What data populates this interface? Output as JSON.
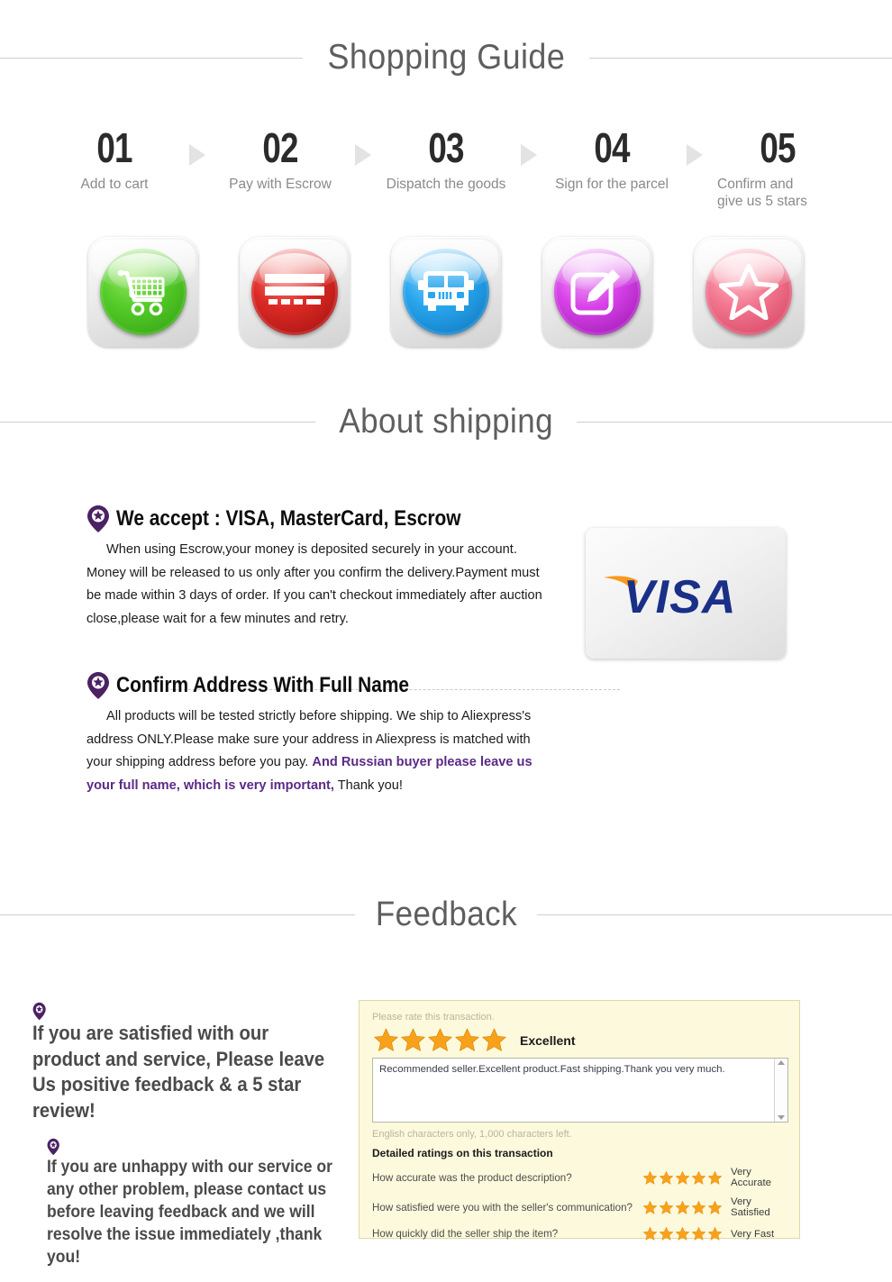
{
  "sections": {
    "shopping_guide": {
      "title": "Shopping Guide"
    },
    "about_shipping": {
      "title": "About shipping"
    },
    "feedback": {
      "title": "Feedback"
    }
  },
  "steps": [
    {
      "num": "01",
      "label": "Add to cart",
      "icon": "shopping-cart-icon",
      "color": "#55cc29"
    },
    {
      "num": "02",
      "label": "Pay with Escrow",
      "icon": "credit-card-icon",
      "color": "#dd2a26"
    },
    {
      "num": "03",
      "label": "Dispatch the goods",
      "icon": "delivery-truck-icon",
      "color": "#29a6ee"
    },
    {
      "num": "04",
      "label": "Sign for the parcel",
      "icon": "sign-edit-icon",
      "color": "#d843e8"
    },
    {
      "num": "05",
      "label": "Confirm and\ngive us 5 stars",
      "label_line1": "Confirm and",
      "label_line2": "give us 5 stars",
      "icon": "star-icon",
      "color": "#f2778f"
    }
  ],
  "shipping": {
    "accept_block": {
      "heading": "We accept : VISA, MasterCard, Escrow",
      "icon": "map-pin-star-icon",
      "body": "When using Escrow,your money is deposited securely in your account. Money will be released to us only after you confirm the delivery.Payment must be made within 3 days of order. If you can't checkout immediately after auction close,please wait for a few minutes and retry."
    },
    "address_block": {
      "heading": "Confirm Address With Full Name",
      "icon": "map-pin-star-icon",
      "body_plain": "All products will be tested strictly before shipping. We ship to Aliexpress's address ONLY.Please make sure your address in Aliexpress is matched with your shipping address before you pay. ",
      "body_highlight": "And Russian buyer please leave us your full name, which is very important,",
      "body_tail": " Thank you!",
      "highlight_color": "#5b2a86"
    },
    "visa_card": {
      "brand": "VISA",
      "icon": "visa-logo",
      "text_color": "#1a2f87",
      "swoosh_color": "#f8991d"
    }
  },
  "feedback": {
    "positive_note": "If you are satisfied with our product and service, Please leave Us positive feedback & a 5 star review!",
    "problem_note": "If you are unhappy with our service or any other problem, please contact us before leaving feedback and we will resolve the issue immediately ,thank you!",
    "pin_icon": "map-pin-star-icon",
    "rating_panel": {
      "prompt": "Please rate this transaction.",
      "overall_stars": 5,
      "overall_label": "Excellent",
      "comment": "Recommended seller.Excellent product.Fast shipping.Thank you very much.",
      "char_note": "English characters only, 1,000 characters left.",
      "detail_title": "Detailed ratings on this transaction",
      "star_color": "#f8a21c",
      "rows": [
        {
          "question": "How accurate was the product description?",
          "stars": 5,
          "verdict": "Very Accurate"
        },
        {
          "question": "How satisfied were you with the seller's communication?",
          "stars": 5,
          "verdict": "Very Satisfied"
        },
        {
          "question": "How quickly did the seller ship the item?",
          "stars": 5,
          "verdict": "Very Fast"
        }
      ]
    }
  }
}
